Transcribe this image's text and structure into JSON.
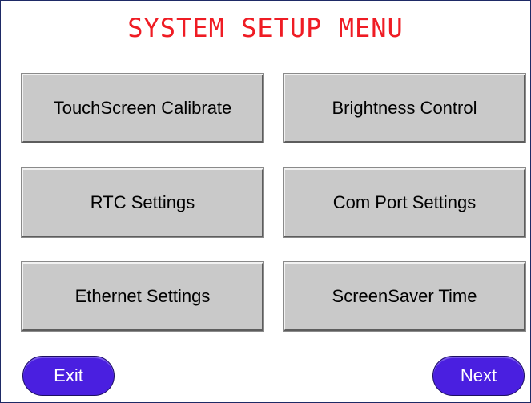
{
  "screen": {
    "title": "SYSTEM SETUP MENU"
  },
  "menu": {
    "items": [
      {
        "label": "TouchScreen Calibrate"
      },
      {
        "label": "Brightness Control"
      },
      {
        "label": "RTC Settings"
      },
      {
        "label": "Com Port Settings"
      },
      {
        "label": "Ethernet Settings"
      },
      {
        "label": "ScreenSaver Time"
      }
    ]
  },
  "nav": {
    "exit_label": "Exit",
    "next_label": "Next"
  },
  "colors": {
    "title": "#ef1c24",
    "button_face": "#c9c9c9",
    "nav_button": "#4a1fe0",
    "frame_border": "#1e2a66"
  }
}
